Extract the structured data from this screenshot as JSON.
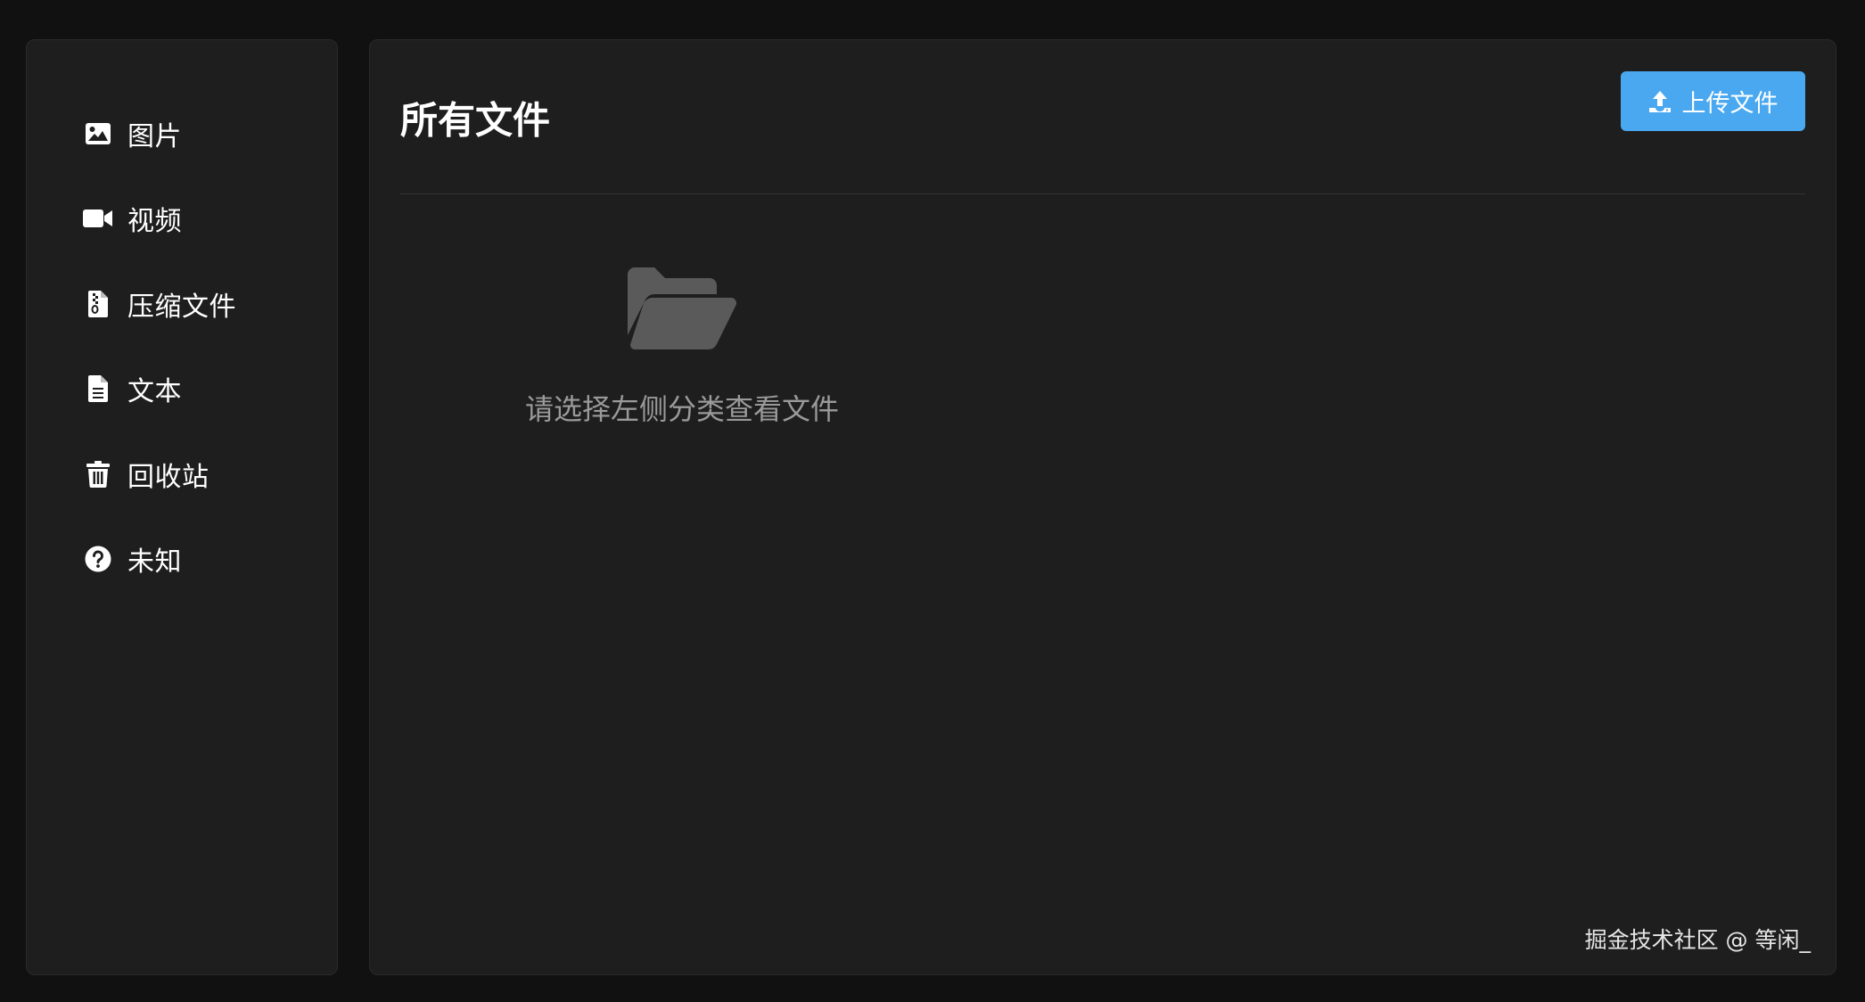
{
  "sidebar": {
    "items": [
      {
        "label": "图片",
        "icon": "image-icon"
      },
      {
        "label": "视频",
        "icon": "video-icon"
      },
      {
        "label": "压缩文件",
        "icon": "zip-file-icon"
      },
      {
        "label": "文本",
        "icon": "text-file-icon"
      },
      {
        "label": "回收站",
        "icon": "trash-icon"
      },
      {
        "label": "未知",
        "icon": "question-circle-icon"
      }
    ]
  },
  "main": {
    "title": "所有文件",
    "upload_label": "上传文件",
    "upload_icon": "upload-icon",
    "empty_icon": "folder-open-icon",
    "empty_text": "请选择左侧分类查看文件"
  },
  "watermark": "掘金技术社区 @ 等闲_",
  "colors": {
    "accent": "#49a8ef",
    "background": "#111111",
    "panel": "#1e1e1e",
    "muted_text": "#9a9a9a",
    "folder": "#5a5a5a"
  }
}
